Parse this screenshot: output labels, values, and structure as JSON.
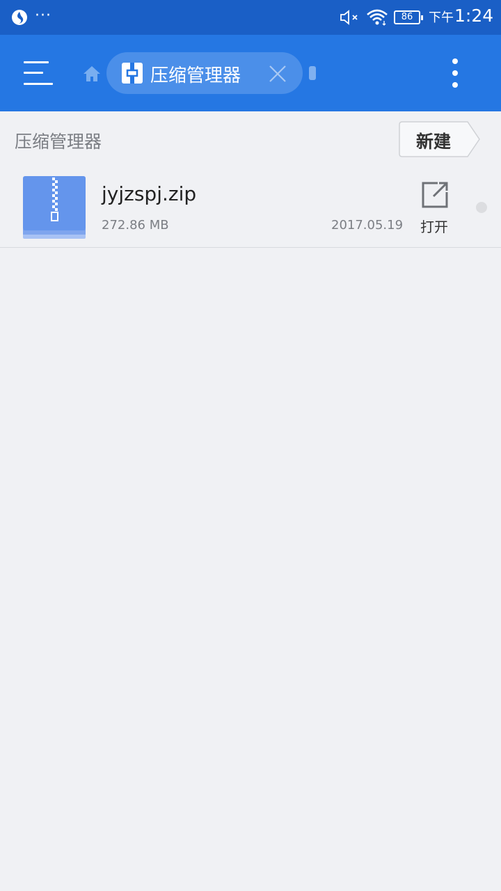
{
  "status_bar": {
    "dots": "···",
    "battery": "86",
    "time_ampm": "下午",
    "time": "1:24",
    "icons": [
      "app-notification-icon",
      "mute-icon",
      "wifi-icon",
      "battery-icon"
    ]
  },
  "app_bar": {
    "menu_icon": "hamburger-menu-icon",
    "home_icon": "home-icon",
    "tab_label": "压缩管理器",
    "tab_icon": "archive-icon",
    "close_icon": "close-icon",
    "more_icon": "more-vert-icon"
  },
  "path_bar": {
    "title": "压缩管理器",
    "new_label": "新建"
  },
  "files": [
    {
      "name": "jyjzspj.zip",
      "size": "272.86 MB",
      "date": "2017.05.19",
      "action_label": "打开",
      "icon": "zip-file-icon",
      "action_icon": "open-external-icon"
    }
  ],
  "colors": {
    "status_bar": "#1a5fc6",
    "app_bar": "#2577e3",
    "chip": "#4b8fe9",
    "background": "#f0f1f4",
    "zip_icon": "#6495ec"
  }
}
